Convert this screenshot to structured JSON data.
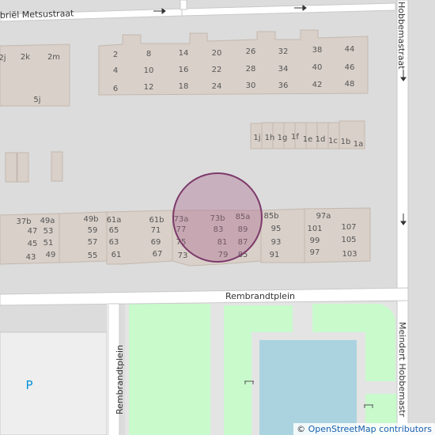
{
  "streets": {
    "metsu": "briël Metsustraat",
    "hobbema_top": "Hobbemastraat",
    "rembrandtplein_h": "Rembrandtplein",
    "rembrandtplein_v": "Rembrandtplein",
    "meindert_hobbema": "Meindert Hobbemastr"
  },
  "poi": {
    "parking": "P"
  },
  "colors": {
    "road": "#ffffff",
    "building": "#d9d0c9",
    "building_stroke": "#c4b8ae",
    "park": "#c8facc",
    "water": "#aad3df",
    "marker_fill": "#a75f87",
    "marker_stroke": "#7d3a6b"
  },
  "marker": {
    "shape": "circle",
    "opacity": 0.35
  },
  "house_numbers": {
    "top_block": [
      "2j",
      "2k",
      "2m",
      "5j",
      "2",
      "8",
      "4",
      "10",
      "6",
      "12",
      "14",
      "20",
      "16",
      "22",
      "18",
      "24",
      "26",
      "32",
      "28",
      "34",
      "30",
      "36",
      "38",
      "44",
      "40",
      "46",
      "42",
      "48"
    ],
    "mid_row": [
      "1j",
      "1h",
      "1g",
      "1f",
      "1e",
      "1d",
      "1c",
      "1b",
      "1a"
    ],
    "bottom_block": [
      "37b",
      "49a",
      "49b",
      "61a",
      "61b",
      "73a",
      "73b",
      "85a",
      "85b",
      "97a",
      "47",
      "53",
      "59",
      "65",
      "71",
      "77",
      "83",
      "89",
      "95",
      "101",
      "107",
      "45",
      "51",
      "57",
      "63",
      "69",
      "75",
      "81",
      "87",
      "93",
      "99",
      "105",
      "43",
      "49",
      "55",
      "61",
      "67",
      "73",
      "79",
      "85",
      "91",
      "97",
      "103"
    ]
  },
  "attribution": {
    "prefix": "©",
    "link_text": "OpenStreetMap contributors"
  }
}
